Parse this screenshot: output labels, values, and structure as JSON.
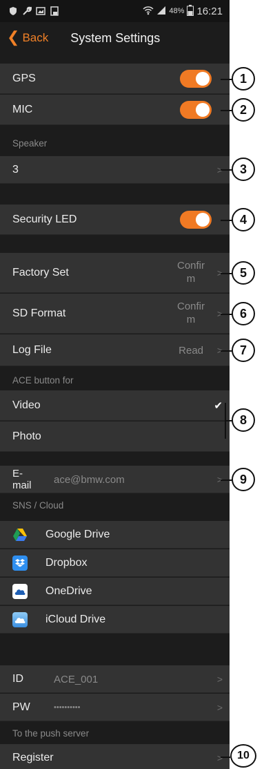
{
  "statusbar": {
    "battery": "48%",
    "time": "16:21"
  },
  "nav": {
    "back_label": "Back",
    "title": "System Settings"
  },
  "settings": {
    "gps_label": "GPS",
    "gps_on": true,
    "mic_label": "MIC",
    "mic_on": true,
    "speaker_section": "Speaker",
    "speaker_value": "3",
    "security_led_label": "Security LED",
    "security_led_on": true,
    "factory_set_label": "Factory Set",
    "factory_set_value": "Confir\nm",
    "sd_format_label": "SD Format",
    "sd_format_value": "Confir\nm",
    "log_file_label": "Log File",
    "log_file_value": "Read",
    "ace_section": "ACE button for",
    "ace_video": "Video",
    "ace_photo": "Photo",
    "email_label": "E-\nmail",
    "email_value": "ace@bmw.com",
    "sns_section": "SNS / Cloud",
    "cloud_items": [
      "Google Drive",
      "Dropbox",
      "OneDrive",
      "iCloud Drive"
    ],
    "id_label": "ID",
    "id_value": "ACE_001",
    "pw_label": "PW",
    "pw_value": "••••••••••",
    "push_section": "To the push server",
    "register_label": "Register"
  },
  "callouts": [
    "1",
    "2",
    "3",
    "4",
    "5",
    "6",
    "7",
    "8",
    "9",
    "10"
  ],
  "colors": {
    "accent": "#f07a24",
    "background": "#1c1c1c",
    "row": "#333333"
  }
}
